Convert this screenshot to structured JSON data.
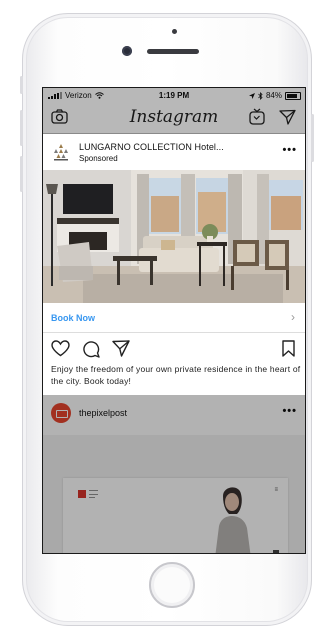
{
  "status_bar": {
    "carrier": "Verizon",
    "time": "1:19 PM",
    "battery": "84%"
  },
  "header": {
    "logo_text": "Instagram"
  },
  "post": {
    "account_name": "LUNGARNO COLLECTION Hotel...",
    "subtitle": "Sponsored",
    "more": "•••",
    "cta_label": "Book Now",
    "caption": "Enjoy the freedom of your own private residence in the heart of the city. Book today!"
  },
  "next_post": {
    "account_name": "thepixelpost",
    "more": "•••"
  },
  "icons": [
    "camera-icon",
    "igtv-icon",
    "direct-icon",
    "heart-icon",
    "comment-icon",
    "share-icon",
    "bookmark-icon",
    "wifi-icon",
    "bluetooth-icon",
    "location-icon",
    "battery-icon"
  ],
  "colors": {
    "link_blue": "#3897f0",
    "avatar_red": "#e8462f"
  }
}
